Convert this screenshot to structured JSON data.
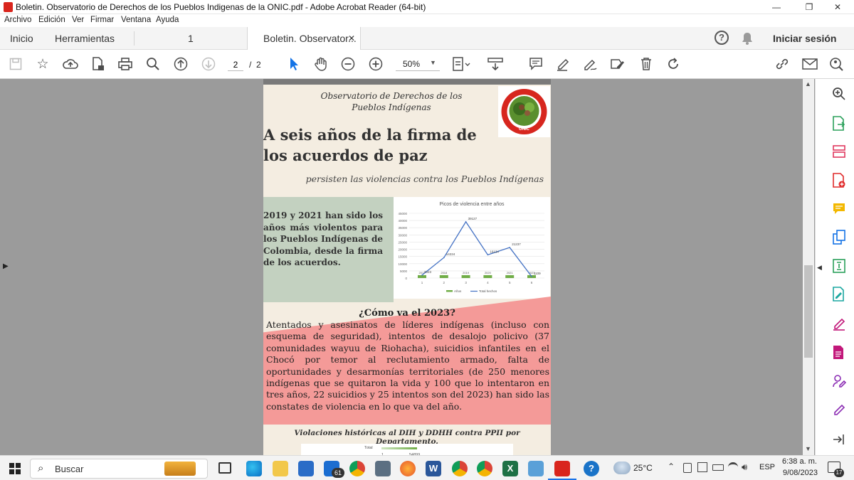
{
  "window": {
    "title": "Boletin. Observatorio de Derechos de los Pueblos Indigenas de la ONIC.pdf - Adobe Acrobat Reader (64-bit)",
    "minimize": "—",
    "maximize": "❐",
    "close": "✕"
  },
  "menu": [
    "Archivo",
    "Edición",
    "Ver",
    "Firmar",
    "Ventana",
    "Ayuda"
  ],
  "tabs": {
    "home": "Inicio",
    "tools": "Herramientas",
    "page_tab": "1",
    "doc_tab": "Boletin. Observator...",
    "doc_tab_close": "✕",
    "help": "?",
    "signin": "Iniciar sesión"
  },
  "toolbar": {
    "page_current": "2",
    "page_sep": "/",
    "page_total": "2",
    "zoom": "50%"
  },
  "pdf": {
    "org": "Observatorio de Derechos de los Pueblos Indígenas",
    "logo_text": "ONIC",
    "headline": "A seis años de la firma de los acuerdos de paz",
    "subheadline": "persisten las violencias contra los Pueblos Indígenas",
    "side_text": "2019 y 2021 han sido los años más violentos para los Pueblos Indígenas de Colombia, desde la firma de los acuerdos.",
    "section_title": "¿Cómo va el 2023?",
    "section_body": "Atentados y asesinatos de líderes indígenas (incluso con esquema de seguridad), intentos de desalojo policivo (37 comunidades wayuu de Riohacha), suicidios infantiles en el Chocó por temor al reclutamiento armado, falta de oportunidades y desarmonías territoriales (de 250 menores indígenas que se quitaron la vida y 100 que lo intentaron en tres años, 22 suicidios y 25 intentos son del 2023) han sido las constates de violencia en lo que va del año.",
    "caption": "Violaciones históricas al DIH y DDHH contra PPII por Departamento.",
    "bottom_chart": {
      "label": "Total",
      "num": "1",
      "value": "54899"
    }
  },
  "chart_data": {
    "type": "line",
    "title": "Picos de violencia entre años",
    "x": [
      1,
      2,
      3,
      4,
      5,
      6
    ],
    "years": [
      "2017",
      "2018",
      "2019",
      "2020",
      "2021",
      "2023"
    ],
    "series": [
      {
        "name": "Años",
        "values": [
          2017,
          2018,
          2019,
          2020,
          2021,
          2023
        ]
      },
      {
        "name": "Total hechos",
        "values": [
          2023,
          14224,
          39127,
          16134,
          21237,
          1109
        ]
      }
    ],
    "value_labels": [
      "2023",
      "14224",
      "39127",
      "16134",
      "21237",
      "1109"
    ],
    "yticks": [
      "0",
      "5000",
      "10000",
      "15000",
      "20000",
      "25000",
      "30000",
      "35000",
      "40000",
      "45000"
    ],
    "xticks": [
      "1",
      "2",
      "3",
      "4",
      "5",
      "6"
    ],
    "ylim": [
      0,
      45000
    ],
    "grid": true,
    "legend": "bottom",
    "colors": {
      "line": "#4472c4",
      "bars": "#70ad47"
    }
  },
  "taskbar": {
    "search": "Buscar",
    "mail_badge": "61",
    "temp": "25°C",
    "lang": "ESP",
    "time": "6:38 a. m.",
    "date": "9/08/2023",
    "notif": "17"
  }
}
